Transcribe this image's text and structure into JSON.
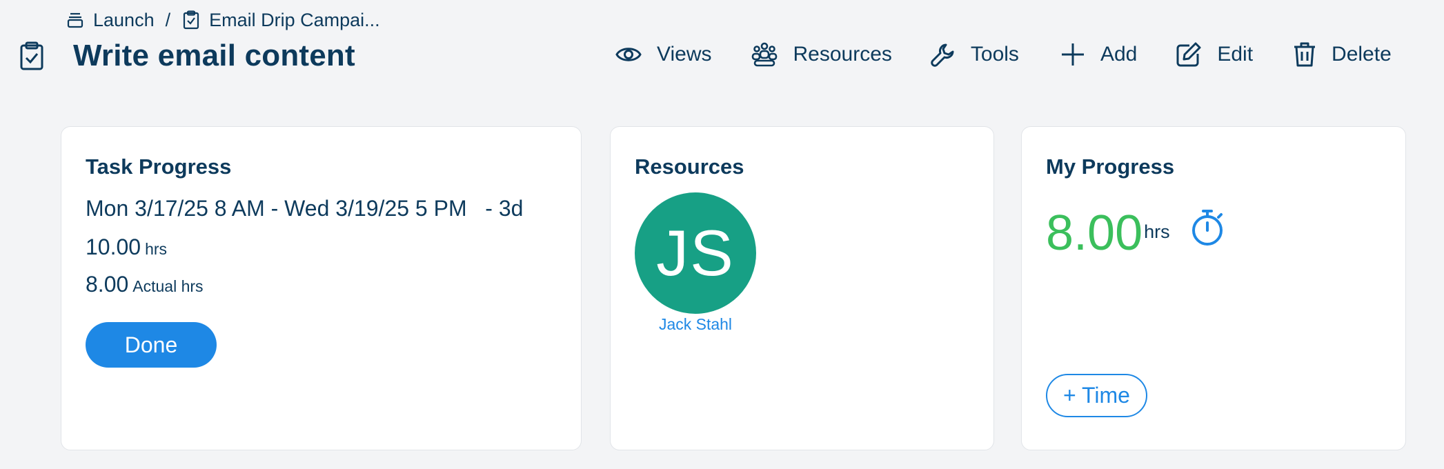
{
  "breadcrumb": {
    "items": [
      {
        "label": "Launch",
        "icon": "stack-icon"
      },
      {
        "label": "Email Drip Campai...",
        "icon": "checklist-icon"
      }
    ],
    "separator": "/"
  },
  "page": {
    "title": "Write email content",
    "icon": "clipboard-check-icon"
  },
  "toolbar": {
    "views": "Views",
    "resources": "Resources",
    "tools": "Tools",
    "add": "Add",
    "edit": "Edit",
    "delete": "Delete"
  },
  "task_progress": {
    "title": "Task Progress",
    "dates": "Mon 3/17/25 8 AM - Wed 3/19/25 5 PM   - 3d",
    "planned_value": "10.00",
    "planned_unit": "hrs",
    "actual_value": "8.00",
    "actual_unit": "Actual hrs",
    "done_label": "Done"
  },
  "resources": {
    "title": "Resources",
    "people": [
      {
        "initials": "JS",
        "name": "Jack Stahl",
        "color": "#17a085"
      }
    ]
  },
  "my_progress": {
    "title": "My Progress",
    "hours": "8.00",
    "unit": "hrs",
    "add_time_label": "+ Time"
  },
  "colors": {
    "text": "#0d3a5c",
    "accent": "#1e88e5",
    "hours_green": "#3bbf5c",
    "background": "#f3f4f6"
  }
}
